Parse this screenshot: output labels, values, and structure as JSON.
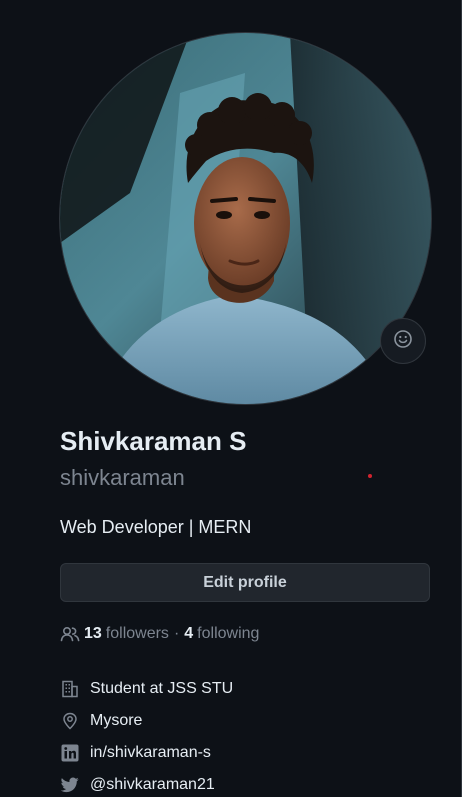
{
  "profile": {
    "name": "Shivkaraman S",
    "login": "shivkaraman",
    "bio": "Web Developer | MERN",
    "edit_label": "Edit profile",
    "followers_count": "13",
    "followers_label": "followers",
    "separator": "·",
    "following_count": "4",
    "following_label": "following"
  },
  "details": {
    "organization": "Student at JSS STU",
    "location": "Mysore",
    "linkedin": "in/shivkaraman-s",
    "twitter": "@shivkaraman21"
  },
  "icons": {
    "avatar": "profile-photo",
    "emoji": "smiley-icon",
    "people": "people-icon",
    "organization": "building-icon",
    "location": "location-pin-icon",
    "linkedin": "linkedin-icon",
    "twitter": "twitter-icon"
  },
  "colors": {
    "background": "#0d1117",
    "text": "#e6edf3",
    "muted": "#7d8590",
    "button_bg": "#21262d",
    "border": "#30363d"
  }
}
